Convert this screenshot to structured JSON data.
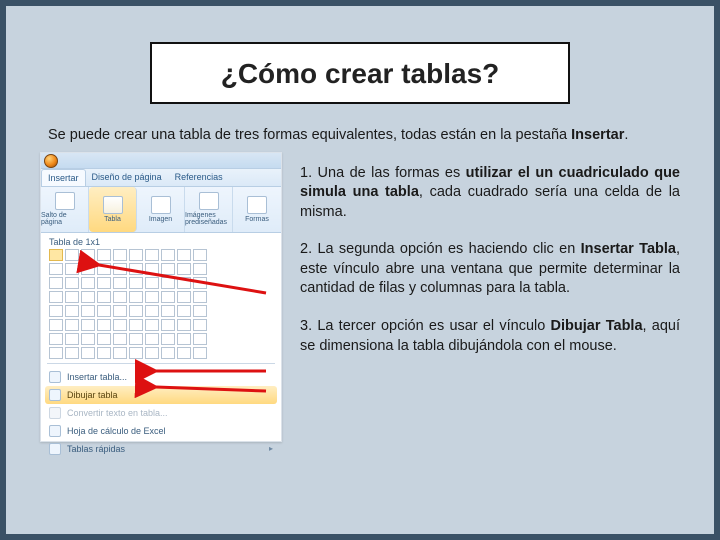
{
  "title": "¿Cómo crear tablas?",
  "intro_part1": "Se puede crear una tabla de tres formas equivalentes, todas están en la pestaña ",
  "intro_bold": "Insertar",
  "intro_part2": ".",
  "screenshot": {
    "tabs": {
      "t0": "Insertar",
      "t1": "Diseño de página",
      "t2": "Referencias"
    },
    "ribbon": {
      "g0": "Salto de página",
      "g1": "Tabla",
      "g2": "Imagen",
      "g3": "Imágenes prediseñadas",
      "g4": "Formas"
    },
    "grid_label": "Tabla de 1x1",
    "menu": {
      "m0": "Insertar tabla...",
      "m1": "Dibujar tabla",
      "m2": "Convertir texto en tabla...",
      "m3": "Hoja de cálculo de Excel",
      "m4": "Tablas rápidas"
    }
  },
  "options": {
    "o1_lead": "1. Una de las formas es ",
    "o1_bold": "utilizar el un cuadriculado que simula una tabla",
    "o1_rest": ", cada cuadrado sería una celda de la misma.",
    "o2_lead": "2. La segunda opción es haciendo clic en ",
    "o2_bold": "Insertar Tabla",
    "o2_rest": ", este vínculo abre una ventana que permite determinar la cantidad de filas y columnas para la tabla.",
    "o3_lead": "3. La tercer opción es usar el vínculo ",
    "o3_bold": "Dibujar Tabla",
    "o3_rest": ", aquí se dimensiona la tabla dibujándola con el mouse."
  }
}
